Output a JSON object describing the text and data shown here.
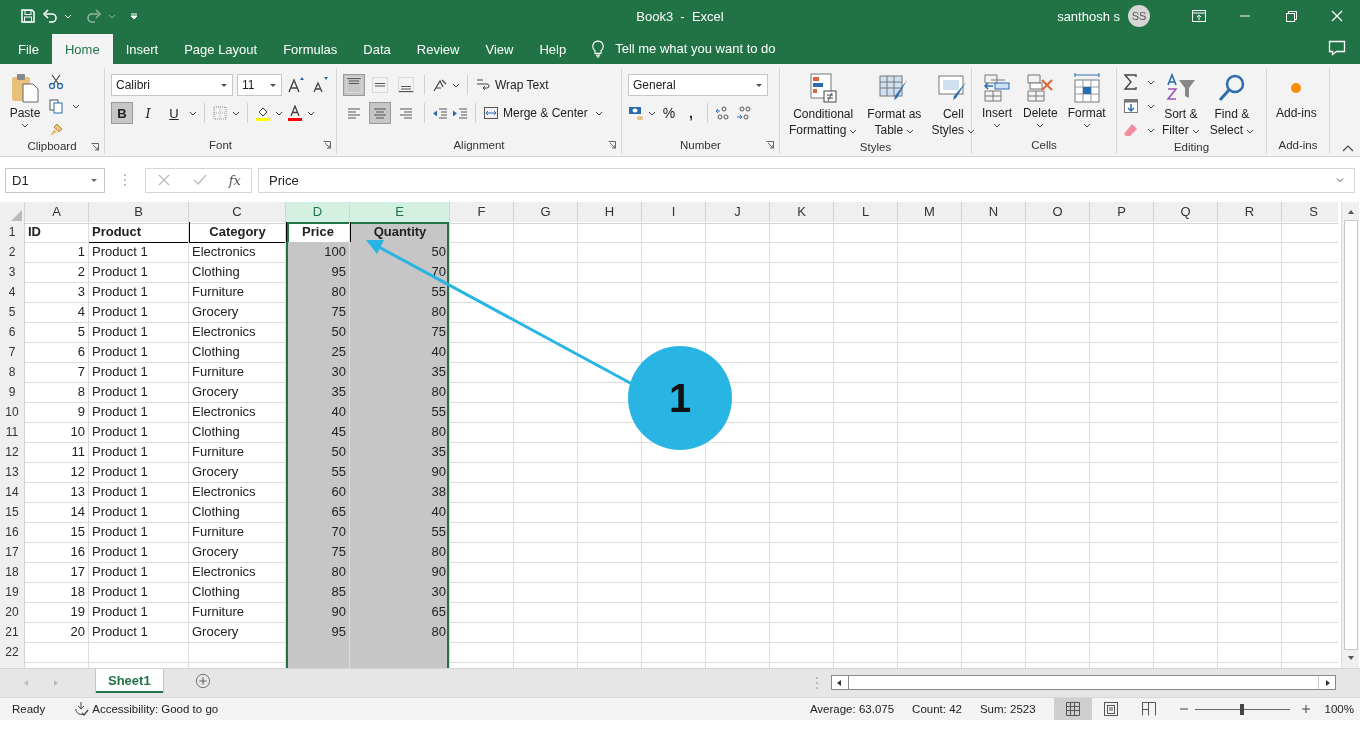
{
  "title_bar": {
    "title": "Book3  -  Excel",
    "user": "santhosh s",
    "avatar": "SS"
  },
  "menu_tabs": [
    {
      "label": "File",
      "selected": false
    },
    {
      "label": "Home",
      "selected": true
    },
    {
      "label": "Insert",
      "selected": false
    },
    {
      "label": "Page Layout",
      "selected": false
    },
    {
      "label": "Formulas",
      "selected": false
    },
    {
      "label": "Data",
      "selected": false
    },
    {
      "label": "Review",
      "selected": false
    },
    {
      "label": "View",
      "selected": false
    },
    {
      "label": "Help",
      "selected": false
    }
  ],
  "tell_me": "Tell me what you want to do",
  "ribbon": {
    "clipboard": {
      "label": "Clipboard",
      "paste": "Paste"
    },
    "font": {
      "label": "Font",
      "name": "Calibri",
      "size": "11",
      "styles": [
        {
          "label": "B",
          "kind": "bold",
          "selected": true
        },
        {
          "label": "I",
          "kind": "italic",
          "selected": false
        },
        {
          "label": "U",
          "kind": "underline",
          "selected": false
        }
      ]
    },
    "alignment": {
      "label": "Alignment",
      "vertical": [
        {
          "kind": "top",
          "selected": true
        },
        {
          "kind": "middle",
          "selected": false
        },
        {
          "kind": "bottom",
          "selected": false
        }
      ],
      "horizontal": [
        {
          "kind": "left",
          "selected": false
        },
        {
          "kind": "center",
          "selected": true
        },
        {
          "kind": "right",
          "selected": false
        }
      ],
      "wrap_text": "Wrap Text",
      "merge_center": "Merge & Center"
    },
    "number": {
      "label": "Number",
      "format": "General",
      "percent": "%",
      "comma": ","
    },
    "styles": {
      "label": "Styles",
      "buttons": [
        {
          "kind": "conditional",
          "line1": "Conditional",
          "line2": "Formatting"
        },
        {
          "kind": "table",
          "line1": "Format as",
          "line2": "Table"
        },
        {
          "kind": "cellstyles",
          "line1": "Cell",
          "line2": "Styles"
        }
      ]
    },
    "cells": {
      "label": "Cells",
      "buttons": [
        {
          "kind": "insert",
          "label": "Insert"
        },
        {
          "kind": "delete",
          "label": "Delete"
        },
        {
          "kind": "format",
          "label": "Format"
        }
      ]
    },
    "editing": {
      "label": "Editing",
      "buttons": [
        {
          "kind": "sort",
          "line1": "Sort &",
          "line2": "Filter"
        },
        {
          "kind": "find",
          "line1": "Find &",
          "line2": "Select"
        }
      ]
    },
    "addins": {
      "label": "Add-ins",
      "button": "Add-ins"
    }
  },
  "formula_bar": {
    "name_box": "D1",
    "function_button": "fx",
    "value": "Price"
  },
  "sheet": {
    "columns": [
      {
        "letter": "A",
        "kind": "number",
        "selected": false
      },
      {
        "letter": "B",
        "kind": "text",
        "selected": false
      },
      {
        "letter": "C",
        "kind": "text",
        "selected": false
      },
      {
        "letter": "D",
        "kind": "number",
        "selected": true
      },
      {
        "letter": "E",
        "kind": "number",
        "selected": true
      },
      {
        "letter": "F",
        "kind": "text",
        "selected": false
      },
      {
        "letter": "G",
        "kind": "text",
        "selected": false
      },
      {
        "letter": "H",
        "kind": "text",
        "selected": false
      },
      {
        "letter": "I",
        "kind": "text",
        "selected": false
      },
      {
        "letter": "J",
        "kind": "text",
        "selected": false
      },
      {
        "letter": "K",
        "kind": "text",
        "selected": false
      },
      {
        "letter": "L",
        "kind": "text",
        "selected": false
      },
      {
        "letter": "M",
        "kind": "text",
        "selected": false
      },
      {
        "letter": "N",
        "kind": "text",
        "selected": false
      },
      {
        "letter": "O",
        "kind": "text",
        "selected": false
      },
      {
        "letter": "P",
        "kind": "text",
        "selected": false
      },
      {
        "letter": "Q",
        "kind": "text",
        "selected": false
      },
      {
        "letter": "R",
        "kind": "text",
        "selected": false
      },
      {
        "letter": "S",
        "kind": "text",
        "selected": false
      }
    ],
    "rows": [
      {
        "number": "1",
        "kind": "header",
        "cells": [
          "ID",
          "Product",
          "Category",
          {
            "text": "Price",
            "active": true
          },
          {
            "text": "Quantity",
            "active": false
          }
        ]
      },
      {
        "number": "2",
        "kind": "data",
        "cells": [
          "1",
          "Product 1",
          "Electronics",
          "100",
          "50"
        ]
      },
      {
        "number": "3",
        "kind": "data",
        "cells": [
          "2",
          "Product 1",
          "Clothing",
          "95",
          "70"
        ]
      },
      {
        "number": "4",
        "kind": "data",
        "cells": [
          "3",
          "Product 1",
          "Furniture",
          "80",
          "55"
        ]
      },
      {
        "number": "5",
        "kind": "data",
        "cells": [
          "4",
          "Product 1",
          "Grocery",
          "75",
          "80"
        ]
      },
      {
        "number": "6",
        "kind": "data",
        "cells": [
          "5",
          "Product 1",
          "Electronics",
          "50",
          "75"
        ]
      },
      {
        "number": "7",
        "kind": "data",
        "cells": [
          "6",
          "Product 1",
          "Clothing",
          "25",
          "40"
        ]
      },
      {
        "number": "8",
        "kind": "data",
        "cells": [
          "7",
          "Product 1",
          "Furniture",
          "30",
          "35"
        ]
      },
      {
        "number": "9",
        "kind": "data",
        "cells": [
          "8",
          "Product 1",
          "Grocery",
          "35",
          "80"
        ]
      },
      {
        "number": "10",
        "kind": "data",
        "cells": [
          "9",
          "Product 1",
          "Electronics",
          "40",
          "55"
        ]
      },
      {
        "number": "11",
        "kind": "data",
        "cells": [
          "10",
          "Product 1",
          "Clothing",
          "45",
          "80"
        ]
      },
      {
        "number": "12",
        "kind": "data",
        "cells": [
          "11",
          "Product 1",
          "Furniture",
          "50",
          "35"
        ]
      },
      {
        "number": "13",
        "kind": "data",
        "cells": [
          "12",
          "Product 1",
          "Grocery",
          "55",
          "90"
        ]
      },
      {
        "number": "14",
        "kind": "data",
        "cells": [
          "13",
          "Product 1",
          "Electronics",
          "60",
          "38"
        ]
      },
      {
        "number": "15",
        "kind": "data",
        "cells": [
          "14",
          "Product 1",
          "Clothing",
          "65",
          "40"
        ]
      },
      {
        "number": "16",
        "kind": "data",
        "cells": [
          "15",
          "Product 1",
          "Furniture",
          "70",
          "55"
        ]
      },
      {
        "number": "17",
        "kind": "data",
        "cells": [
          "16",
          "Product 1",
          "Grocery",
          "75",
          "80"
        ]
      },
      {
        "number": "18",
        "kind": "data",
        "cells": [
          "17",
          "Product 1",
          "Electronics",
          "80",
          "90"
        ]
      },
      {
        "number": "19",
        "kind": "data",
        "cells": [
          "18",
          "Product 1",
          "Clothing",
          "85",
          "30"
        ]
      },
      {
        "number": "20",
        "kind": "data",
        "cells": [
          "19",
          "Product 1",
          "Furniture",
          "90",
          "65"
        ]
      },
      {
        "number": "21",
        "kind": "data",
        "cells": [
          "20",
          "Product 1",
          "Grocery",
          "95",
          "80"
        ]
      },
      {
        "number": "22",
        "kind": "data",
        "cells": []
      }
    ]
  },
  "sheet_tabs": [
    {
      "label": "Sheet1",
      "selected": true
    }
  ],
  "status_bar": {
    "mode": "Ready",
    "accessibility": "Accessibility: Good to go",
    "average": "Average: 63.075",
    "count": "Count: 42",
    "sum": "Sum: 2523",
    "views": [
      {
        "kind": "normal",
        "selected": true
      },
      {
        "kind": "page_layout",
        "selected": false
      },
      {
        "kind": "page_break",
        "selected": false
      }
    ],
    "zoom": {
      "level": 0.5,
      "label": "100%"
    }
  },
  "annotation": {
    "label": "1"
  }
}
